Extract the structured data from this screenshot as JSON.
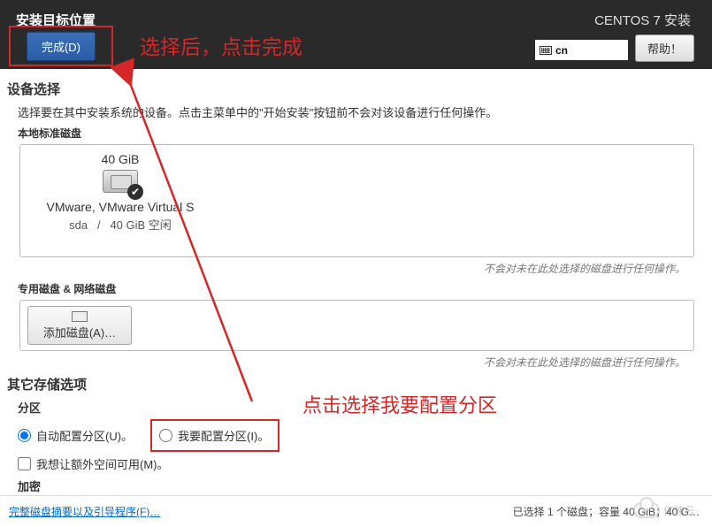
{
  "header": {
    "title": "安装目标位置",
    "installer": "CENTOS 7 安装",
    "done_label": "完成(D)",
    "lang_code": "cn",
    "help_label": "帮助！"
  },
  "annotations": {
    "after_select_click_done": "选择后，点击完成",
    "click_choose_configure": "点击选择我要配置分区"
  },
  "device": {
    "section_title": "设备选择",
    "instruction": "选择要在其中安装系统的设备。点击主菜单中的\"开始安装\"按钮前不会对该设备进行任何操作。",
    "local_heading": "本地标准磁盘",
    "disk": {
      "size": "40 GiB",
      "name": "VMware, VMware Virtual S",
      "dev": "sda",
      "sep": "/",
      "free": "40 GiB 空闲"
    },
    "note_no_action": "不会对未在此处选择的磁盘进行任何操作。",
    "special_heading": "专用磁盘 & 网络磁盘",
    "add_disk_label": "添加磁盘(A)…"
  },
  "storage": {
    "section_title": "其它存储选项",
    "partition_heading": "分区",
    "auto_label": "自动配置分区(U)。",
    "manual_label": "我要配置分区(I)。",
    "extra_space_label": "我想让额外空间可用(M)。",
    "encrypt_heading": "加密"
  },
  "footer": {
    "summary_link": "完整磁盘摘要以及引导程序(F)…",
    "status": "已选择 1 个磁盘；容量 40 GiB；40 G…"
  },
  "watermark": "亿速云"
}
